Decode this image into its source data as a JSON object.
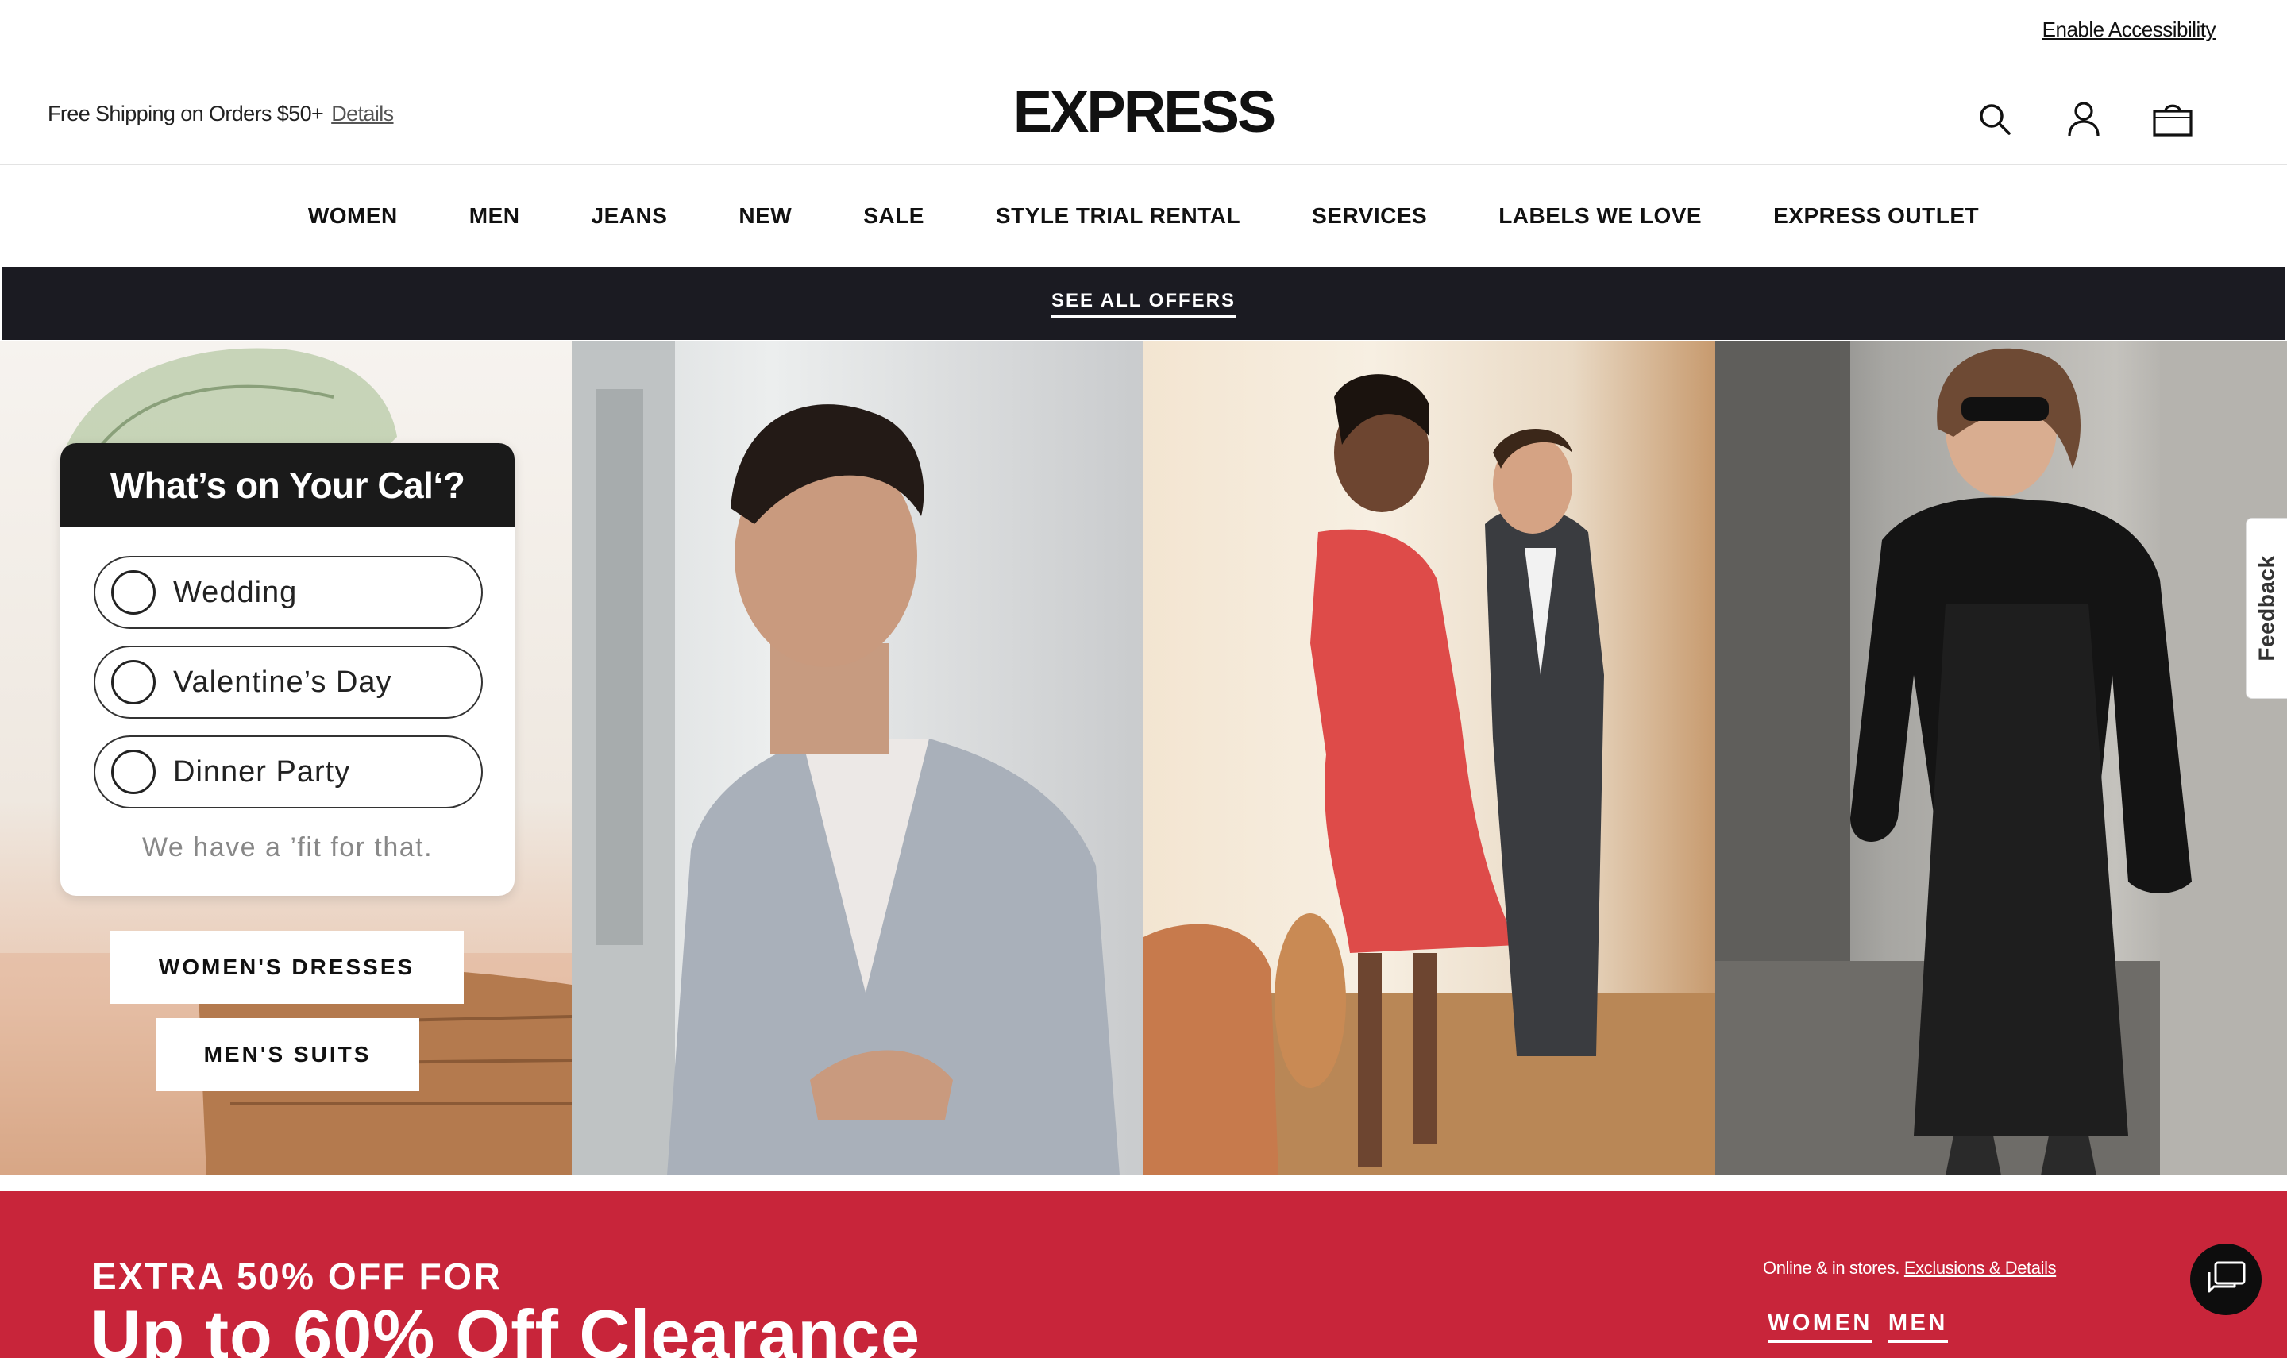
{
  "header": {
    "accessibility_link": "Enable Accessibility",
    "shipping_text": "Free Shipping on Orders $50+",
    "shipping_details_link": "Details",
    "logo": "EXPRESS",
    "icons": [
      "search-icon",
      "account-icon",
      "bag-icon"
    ]
  },
  "nav": {
    "items": [
      "WOMEN",
      "MEN",
      "JEANS",
      "NEW",
      "SALE",
      "STYLE TRIAL RENTAL",
      "SERVICES",
      "LABELS WE LOVE",
      "EXPRESS OUTLET"
    ]
  },
  "offers_bar": {
    "label": "SEE ALL OFFERS",
    "background": "#1b1b22"
  },
  "hero": {
    "calendar_card": {
      "title": "What’s on Your Cal‘?",
      "options": [
        "Wedding",
        "Valentine’s Day",
        "Dinner Party"
      ],
      "footer": "We have a ’fit for that."
    },
    "cta_womens": "WOMEN'S DRESSES",
    "cta_mens": "MEN'S SUITS"
  },
  "feedback_tab": "Feedback",
  "promo": {
    "eyebrow": "EXTRA 50% OFF FOR",
    "headline": "Up to 60% Off Clearance",
    "note": "Online & in stores.",
    "note_link": "Exclusions & Details",
    "tabs": [
      "WOMEN",
      "MEN"
    ],
    "background": "#c8253a"
  },
  "chat_button": "chat-icon"
}
